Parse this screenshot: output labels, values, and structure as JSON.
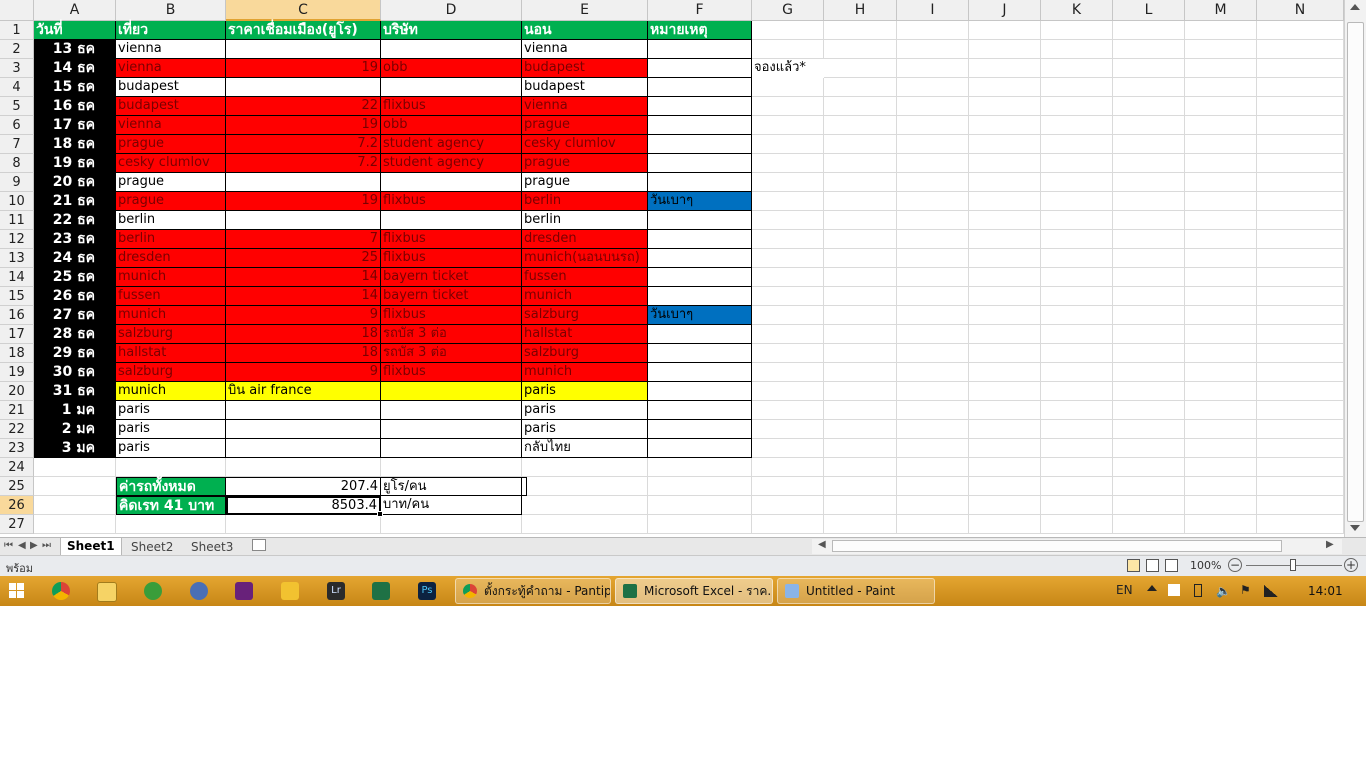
{
  "columns": [
    "A",
    "B",
    "C",
    "D",
    "E",
    "F",
    "G",
    "H",
    "I",
    "J",
    "K",
    "L",
    "M",
    "N"
  ],
  "header_row": {
    "a": "วันที่",
    "b": "เที่ยว",
    "c": "ราคาเชื่อมเมือง(ยูโร)",
    "d": "บริษัท",
    "e": "นอน",
    "f": "หมายเหตุ"
  },
  "rows": [
    {
      "date": "13 ธค",
      "b": "vienna",
      "c": "",
      "d": "",
      "e": "vienna",
      "f": "",
      "style": "white"
    },
    {
      "date": "14 ธค",
      "b": "vienna",
      "c": "19",
      "d": "obb",
      "e": "budapest",
      "f": "",
      "style": "red",
      "g": "จองแล้ว*"
    },
    {
      "date": "15 ธค",
      "b": "budapest",
      "c": "",
      "d": "",
      "e": "budapest",
      "f": "",
      "style": "white"
    },
    {
      "date": "16 ธค",
      "b": "budapest",
      "c": "22",
      "d": "flixbus",
      "e": "vienna",
      "f": "",
      "style": "red"
    },
    {
      "date": "17 ธค",
      "b": "vienna",
      "c": "19",
      "d": "obb",
      "e": "prague",
      "f": "",
      "style": "red"
    },
    {
      "date": "18 ธค",
      "b": "prague",
      "c": "7.2",
      "d": "student agency",
      "e": "cesky clumlov",
      "f": "",
      "style": "red"
    },
    {
      "date": "19 ธค",
      "b": "cesky clumlov",
      "c": "7.2",
      "d": "student agency",
      "e": "prague",
      "f": "",
      "style": "red"
    },
    {
      "date": "20 ธค",
      "b": "prague",
      "c": "",
      "d": "",
      "e": "prague",
      "f": "",
      "style": "white"
    },
    {
      "date": "21 ธค",
      "b": "prague",
      "c": "19",
      "d": "flixbus",
      "e": "berlin",
      "f": "วันเบาๆ",
      "style": "red",
      "fblue": true
    },
    {
      "date": "22 ธค",
      "b": "berlin",
      "c": "",
      "d": "",
      "e": "berlin",
      "f": "",
      "style": "white"
    },
    {
      "date": "23 ธค",
      "b": "berlin",
      "c": "7",
      "d": "flixbus",
      "e": "dresden",
      "f": "",
      "style": "red"
    },
    {
      "date": "24 ธค",
      "b": "dresden",
      "c": "25",
      "d": "flixbus",
      "e": "munich(นอนบนรถ)",
      "f": "",
      "style": "red"
    },
    {
      "date": "25 ธค",
      "b": "munich",
      "c": "14",
      "d": "bayern ticket",
      "e": "fussen",
      "f": "",
      "style": "red"
    },
    {
      "date": "26 ธค",
      "b": "fussen",
      "c": "14",
      "d": "bayern ticket",
      "e": "munich",
      "f": "",
      "style": "red"
    },
    {
      "date": "27 ธค",
      "b": "munich",
      "c": "9",
      "d": "flixbus",
      "e": "salzburg",
      "f": "วันเบาๆ",
      "style": "red",
      "fblue": true
    },
    {
      "date": "28 ธค",
      "b": "salzburg",
      "c": "18",
      "d": "รถบัส 3 ต่อ",
      "e": "hallstat",
      "f": "",
      "style": "red"
    },
    {
      "date": "29 ธค",
      "b": "hallstat",
      "c": "18",
      "d": "รถบัส 3 ต่อ",
      "e": "salzburg",
      "f": "",
      "style": "red"
    },
    {
      "date": "30 ธค",
      "b": "salzburg",
      "c": "9",
      "d": "flixbus",
      "e": "munich",
      "f": "",
      "style": "red"
    },
    {
      "date": "31 ธค",
      "b": "munich",
      "c": "บิน air france",
      "d": "",
      "e": "paris",
      "f": "",
      "style": "yellow",
      "ctext": true
    },
    {
      "date": "1 มค",
      "b": "paris",
      "c": "",
      "d": "",
      "e": "paris",
      "f": "",
      "style": "white"
    },
    {
      "date": "2 มค",
      "b": "paris",
      "c": "",
      "d": "",
      "e": "paris",
      "f": "",
      "style": "white"
    },
    {
      "date": "3 มค",
      "b": "paris",
      "c": "",
      "d": "",
      "e": "กลับไทย",
      "f": "",
      "style": "white"
    }
  ],
  "row_numbers": [
    "1",
    "2",
    "3",
    "4",
    "5",
    "6",
    "7",
    "8",
    "9",
    "10",
    "11",
    "12",
    "13",
    "14",
    "15",
    "16",
    "17",
    "18",
    "19",
    "20",
    "21",
    "22",
    "23",
    "24",
    "25",
    "26",
    "27"
  ],
  "summary": {
    "total_label": "ค่ารถทั้งหมด",
    "total_value": "207.4",
    "total_unit": "ยูโร/คน",
    "baht_label": "คิดเรท 41 บาท",
    "baht_value": "8503.4",
    "baht_unit": "บาท/คน"
  },
  "sheet_tabs": [
    "Sheet1",
    "Sheet2",
    "Sheet3"
  ],
  "status": {
    "ready": "พร้อม",
    "zoom": "100%"
  },
  "taskbar": {
    "windows": [
      "ตั้งกระทู้คำถาม - Pantip...",
      "Microsoft Excel - ราค...",
      "Untitled - Paint"
    ],
    "lang": "EN",
    "time": "14:01"
  },
  "colors": {
    "red": "#ff0000",
    "green": "#00b050",
    "yellow": "#ffff00",
    "blue": "#0070c0"
  }
}
